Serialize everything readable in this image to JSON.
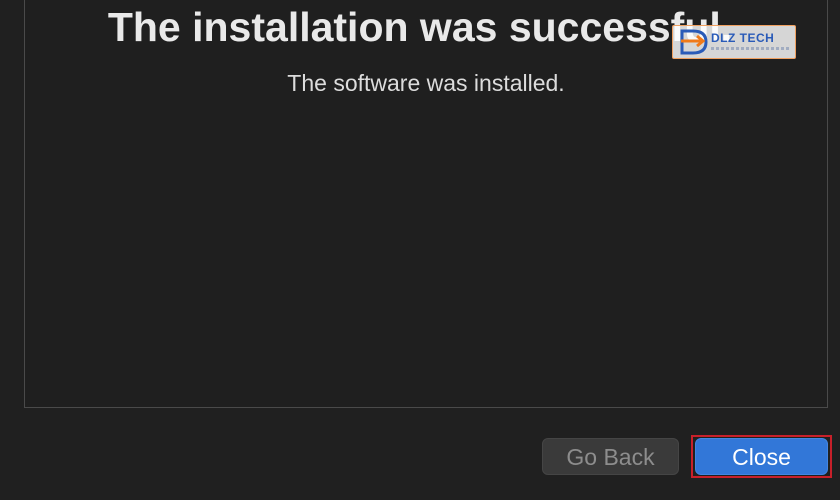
{
  "dialog": {
    "title": "The installation was successful.",
    "subtitle": "The software was installed."
  },
  "buttons": {
    "go_back_label": "Go Back",
    "close_label": "Close"
  },
  "watermark": {
    "brand": "DLZ TECH"
  },
  "colors": {
    "background": "#202020",
    "primary_button": "#3277d8",
    "disabled_button": "#3a3a3a",
    "highlight_frame": "#c8202a"
  }
}
